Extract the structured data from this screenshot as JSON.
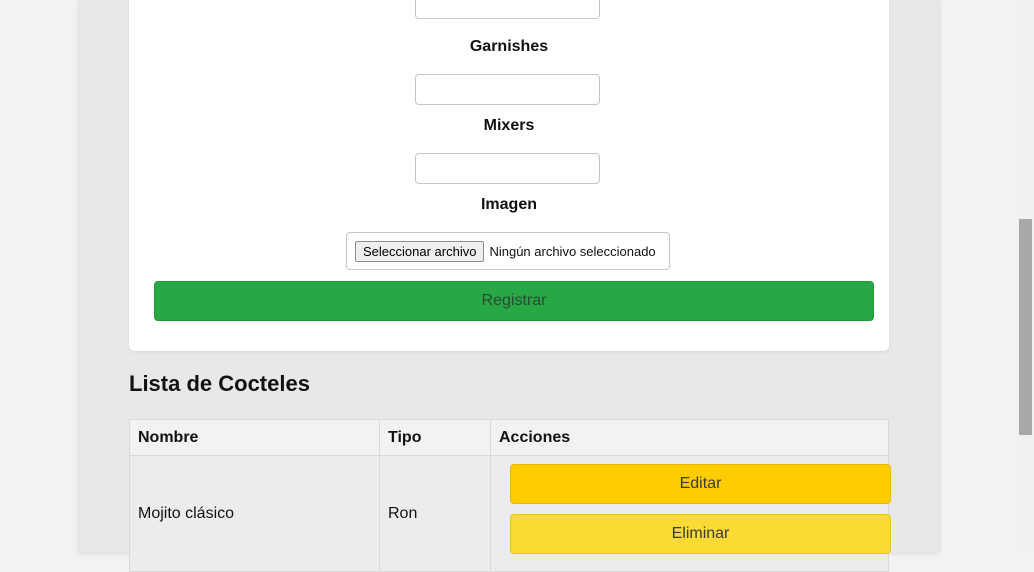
{
  "form": {
    "labels": {
      "garnishes": "Garnishes",
      "mixers": "Mixers",
      "imagen": "Imagen"
    },
    "file_input": {
      "button_label": "Seleccionar archivo",
      "status": "Ningún archivo seleccionado"
    },
    "submit_label": "Registrar"
  },
  "list": {
    "title": "Lista de Cocteles",
    "columns": [
      "Nombre",
      "Tipo",
      "Acciones"
    ],
    "rows": [
      {
        "nombre": "Mojito clásico",
        "tipo": "Ron",
        "edit_label": "Editar",
        "delete_label": "Eliminar"
      }
    ]
  },
  "colors": {
    "submit": "#28a745",
    "edit": "#ffcc00",
    "delete": "#fbdb33"
  }
}
